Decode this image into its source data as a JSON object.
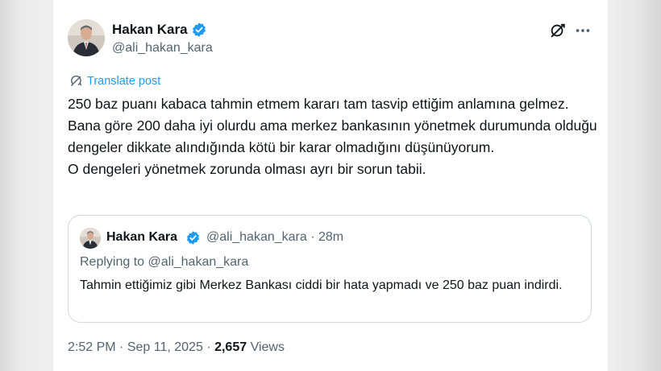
{
  "tweet": {
    "author_name": "Hakan Kara",
    "author_handle": "@ali_hakan_kara",
    "translate_label": "Translate post",
    "text_lines": [
      "250 baz puanı kabaca tahmin etmem kararı tam tasvip ettiğim anlamına gelmez. Bana göre 200 daha iyi olurdu ama merkez bankasının yönetmek durumunda olduğu dengeler dikkate alındığında kötü bir karar olmadığını düşünüyorum.",
      "O dengeleri yönetmek zorunda olması ayrı bir sorun tabii."
    ],
    "time": "2:52 PM",
    "date": "Sep 11, 2025",
    "views_count": "2,657",
    "views_label": "Views",
    "separator": "·"
  },
  "quote": {
    "author_name": "Hakan Kara",
    "author_handle": "@ali_hakan_kara",
    "age": "28m",
    "separator": "·",
    "replying_to": "Replying to @ali_hakan_kara",
    "text": "Tahmin ettiğimiz gibi Merkez Bankası ciddi bir hata yapmadı ve 250 baz puan indirdi."
  },
  "icons": {
    "verified": "verified-badge-icon",
    "grok": "grok-icon",
    "more": "more-dots-icon",
    "translate": "translate-icon"
  },
  "colors": {
    "accent": "#1d9bf0",
    "text": "#0f1419",
    "muted": "#536471",
    "border": "#cfd9de"
  }
}
